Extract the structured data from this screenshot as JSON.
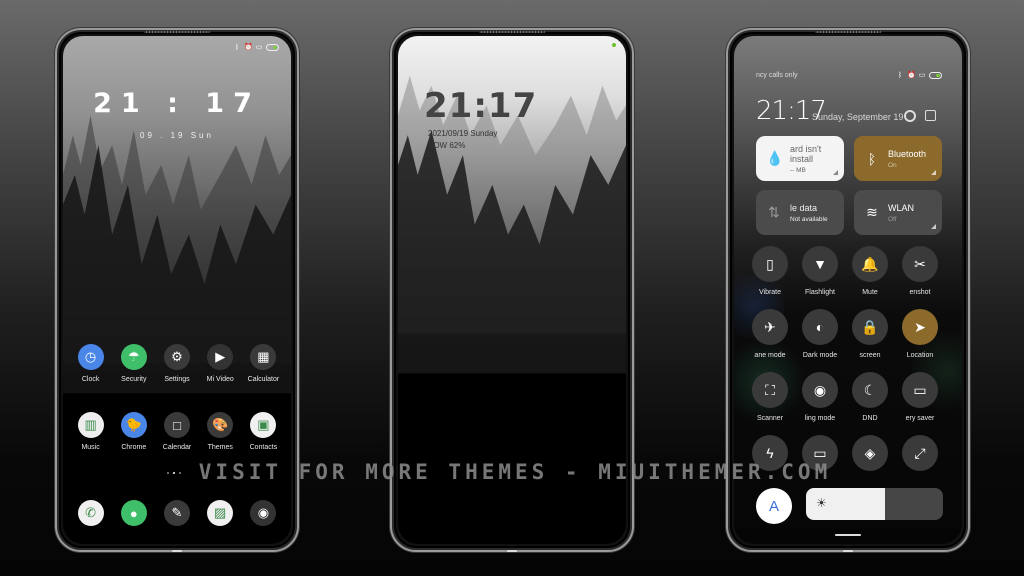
{
  "watermark": "VISIT FOR MORE THEMES - MIUITHEMER.COM",
  "phone1": {
    "status_icons": [
      "bluetooth-icon",
      "alarm-icon",
      "sim-icon",
      "battery-icon"
    ],
    "clock": "21 : 17",
    "date": "09 . 19 Sun",
    "apps_row1": [
      {
        "label": "Clock",
        "icon": "clock-icon",
        "color": "#4a86e8",
        "glyph": "◷"
      },
      {
        "label": "Security",
        "icon": "umbrella-icon",
        "color": "#3fbf6a",
        "glyph": "☂"
      },
      {
        "label": "Settings",
        "icon": "gear-icon",
        "color": "#3a3a3a",
        "glyph": "⚙"
      },
      {
        "label": "Mi Video",
        "icon": "video-icon",
        "color": "#333333",
        "glyph": "▶"
      },
      {
        "label": "Calculator",
        "icon": "calculator-icon",
        "color": "#3a3a3a",
        "glyph": "▦"
      }
    ],
    "apps_row2": [
      {
        "label": "Music",
        "icon": "piano-icon",
        "color": "#eeeeee",
        "glyph": "▥"
      },
      {
        "label": "Chrome",
        "icon": "duck-icon",
        "color": "#4a86e8",
        "glyph": "🐤"
      },
      {
        "label": "Calendar",
        "icon": "calendar-icon",
        "color": "#3a3a3a",
        "glyph": "□"
      },
      {
        "label": "Themes",
        "icon": "palette-icon",
        "color": "#3a3a3a",
        "glyph": "🎨"
      },
      {
        "label": "Contacts",
        "icon": "contacts-icon",
        "color": "#f0f0f0",
        "glyph": "▣"
      }
    ],
    "dock": [
      {
        "icon": "phone-icon",
        "color": "#f0f0f0",
        "glyph": "✆"
      },
      {
        "icon": "messages-icon",
        "color": "#3fbf6a",
        "glyph": "●"
      },
      {
        "icon": "notes-icon",
        "color": "#3a3a3a",
        "glyph": "✎"
      },
      {
        "icon": "gallery-icon",
        "color": "#f0f0f0",
        "glyph": "▨"
      },
      {
        "icon": "camera-icon",
        "color": "#333333",
        "glyph": "◉"
      }
    ],
    "page_dots": 3,
    "active_dot": 1
  },
  "phone2": {
    "clock": "21:17",
    "date": "2021/09/19 Sunday",
    "power": "POW  62%"
  },
  "phone3": {
    "carrier": "ncy calls only",
    "time": "21:17",
    "date": "Sunday, September 19",
    "tiles": {
      "data_usage": {
        "title": "ard isn't install",
        "sub": "-- MB"
      },
      "bluetooth": {
        "title": "Bluetooth",
        "sub": "On"
      },
      "mobile_data": {
        "title": "le data",
        "sub": "Not available"
      },
      "wlan": {
        "title": "WLAN",
        "sub": "Off"
      }
    },
    "toggles": [
      {
        "label": "Vibrate",
        "icon": "vibrate-icon",
        "glyph": "▯",
        "on": false
      },
      {
        "label": "Flashlight",
        "icon": "flashlight-icon",
        "glyph": "▼",
        "on": false
      },
      {
        "label": "Mute",
        "icon": "bell-icon",
        "glyph": "🔔",
        "on": false
      },
      {
        "label": "enshot",
        "icon": "screenshot-icon",
        "glyph": "✂",
        "on": false
      },
      {
        "label": "ane mode",
        "icon": "airplane-icon",
        "glyph": "✈",
        "on": false
      },
      {
        "label": "Dark mode",
        "icon": "dark-mode-icon",
        "glyph": "◐",
        "on": false
      },
      {
        "label": "screen",
        "icon": "lock-icon",
        "glyph": "🔒",
        "on": false
      },
      {
        "label": "Location",
        "icon": "location-icon",
        "glyph": "➤",
        "on": true
      },
      {
        "label": "Scanner",
        "icon": "scanner-icon",
        "glyph": "⛶",
        "on": false
      },
      {
        "label": "ling mode",
        "icon": "eye-icon",
        "glyph": "◉",
        "on": false
      },
      {
        "label": "DND",
        "icon": "moon-icon",
        "glyph": "☾",
        "on": false
      },
      {
        "label": "ery saver",
        "icon": "battery-saver-icon",
        "glyph": "▭",
        "on": false
      },
      {
        "label": "",
        "icon": "lightning-icon",
        "glyph": "ϟ",
        "on": false
      },
      {
        "label": "",
        "icon": "cast-icon",
        "glyph": "▭",
        "on": false
      },
      {
        "label": "",
        "icon": "mi-share-icon",
        "glyph": "◈",
        "on": false
      },
      {
        "label": "",
        "icon": "fullscreen-icon",
        "glyph": "⤢",
        "on": false
      }
    ],
    "auto_brightness_label": "A",
    "brightness_level": 0.58
  }
}
